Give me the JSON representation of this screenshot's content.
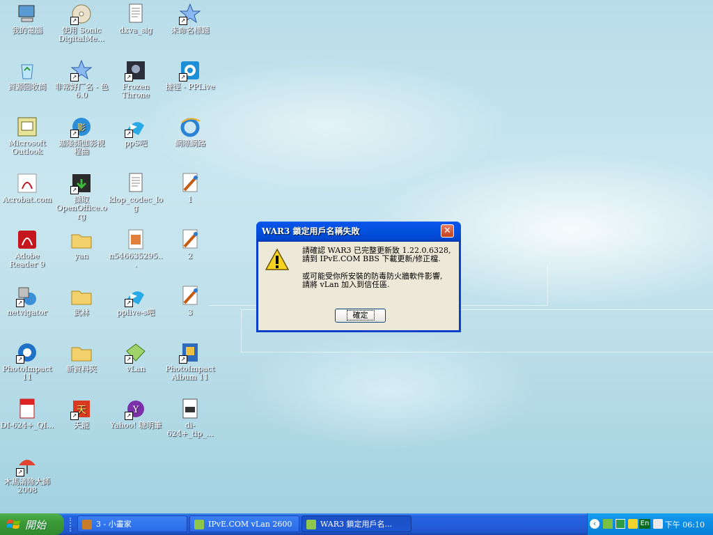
{
  "desktop": {
    "icons": [
      {
        "label": "我的電腦",
        "icon": "my-computer-icon"
      },
      {
        "label": "使用 Sonic DigitalMe...",
        "icon": "cd-icon"
      },
      {
        "label": "dxva_sig",
        "icon": "text-document-icon"
      },
      {
        "label": "未命名標題",
        "icon": "star-icon"
      },
      {
        "label": "資源回收筒",
        "icon": "recycle-bin-icon"
      },
      {
        "label": "非常好厂名 - 色6.0",
        "icon": "star-icon"
      },
      {
        "label": "Frozen Throne",
        "icon": "warcraft-icon"
      },
      {
        "label": "捷徑 - PPLive",
        "icon": "pplive-icon"
      },
      {
        "label": "Microsoft Outlook",
        "icon": "outlook-icon"
      },
      {
        "label": "迦陵頻伽影視 程曲",
        "icon": "media-icon"
      },
      {
        "label": "ppS吧",
        "icon": "ppstream-icon"
      },
      {
        "label": "網際網路",
        "icon": "internet-explorer-icon"
      },
      {
        "label": "Acrobat.com",
        "icon": "acrobat-com-icon"
      },
      {
        "label": "擷取 OpenOffice.org",
        "icon": "openoffice-icon"
      },
      {
        "label": "klop_codec_log",
        "icon": "text-document-icon"
      },
      {
        "label": "1",
        "icon": "paint-icon"
      },
      {
        "label": "Adobe Reader 9",
        "icon": "adobe-reader-icon"
      },
      {
        "label": "yan",
        "icon": "folder-icon"
      },
      {
        "label": "n546635295...",
        "icon": "image-file-icon"
      },
      {
        "label": "2",
        "icon": "paint-icon"
      },
      {
        "label": "netvigator",
        "icon": "netvigator-icon"
      },
      {
        "label": "武林",
        "icon": "folder-icon"
      },
      {
        "label": "pplive-s吧",
        "icon": "ppstream-icon"
      },
      {
        "label": "3",
        "icon": "paint-icon"
      },
      {
        "label": "PhotoImpact 11",
        "icon": "photoimpact-icon"
      },
      {
        "label": "新資料夾",
        "icon": "folder-icon"
      },
      {
        "label": "vLan",
        "icon": "vlan-icon"
      },
      {
        "label": "PhotoImpact Album 11",
        "icon": "photo-album-icon"
      },
      {
        "label": "DI-624+_QI...",
        "icon": "pdf-file-icon"
      },
      {
        "label": "天龍",
        "icon": "game-icon"
      },
      {
        "label": "Yahoo! 聰明筆",
        "icon": "yahoo-icon"
      },
      {
        "label": "di-624+_tip_...",
        "icon": "document-icon"
      },
      {
        "label": "木馬清除大師 2008",
        "icon": "umbrella-icon"
      }
    ]
  },
  "dialog": {
    "title": "WAR3 鎖定用戶名稱失敗",
    "message_line1": "請確認 WAR3 已完整更新致 1.22.0.6328,",
    "message_line2": "請到 IPvE.COM BBS 下載更新/修正檔.",
    "message_line3": "或可能受你所安裝的防毒防火牆軟件影響,",
    "message_line4": "請將 vLan 加入到信任區.",
    "ok_label": "確定",
    "close_glyph": "✕"
  },
  "taskbar": {
    "start_label": "開始",
    "tasks": [
      {
        "label": "3 - 小畫家",
        "active": false
      },
      {
        "label": "IPvE.COM vLan 2600",
        "active": false
      },
      {
        "label": "WAR3 鎖定用戶名...",
        "active": true
      }
    ],
    "tray": {
      "language": "En",
      "clock": "下午 06:10"
    }
  },
  "colors": {
    "taskbar_blue": "#245edb",
    "start_green": "#3b9a38",
    "dialog_face": "#ece9d8",
    "titlebar_blue": "#0350dd",
    "close_red": "#c7411d"
  }
}
